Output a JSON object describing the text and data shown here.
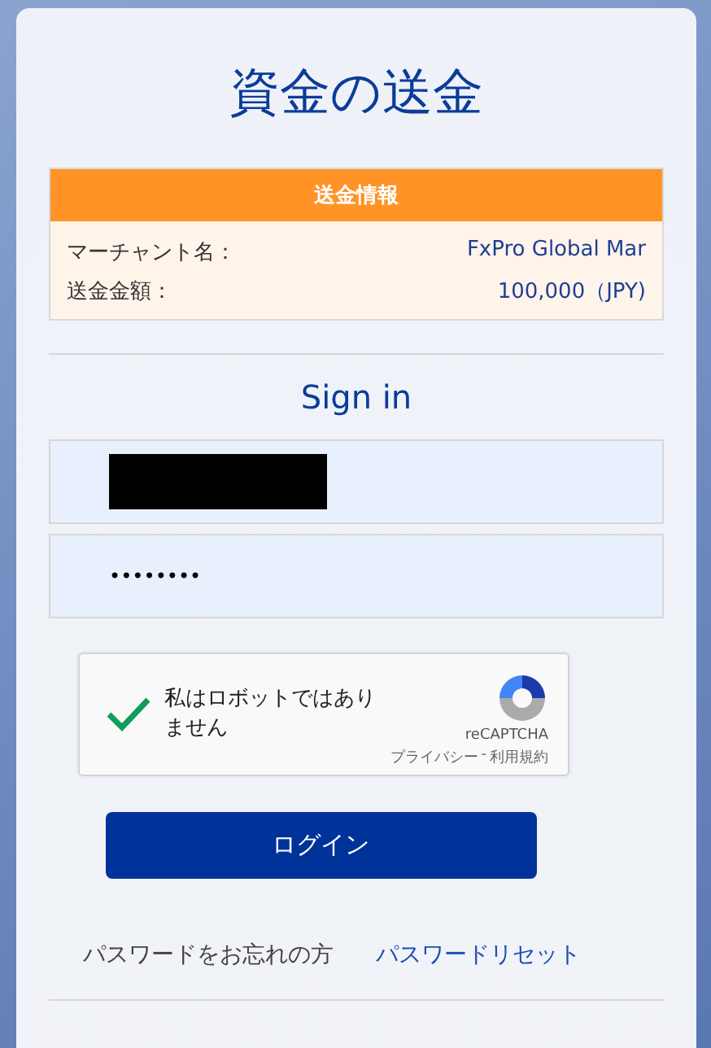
{
  "title": "資金の送金",
  "transfer_info": {
    "header": "送金情報",
    "rows": [
      {
        "label": "マーチャント名：",
        "value": "FxPro Global Mar"
      },
      {
        "label": "送金金額：",
        "value": "100,000（JPY)"
      }
    ]
  },
  "sign_in": {
    "heading": "Sign in",
    "username": {
      "redacted": true
    },
    "password": {
      "value": "••••••••"
    }
  },
  "captcha": {
    "checked": true,
    "label": "私はロボットではありません",
    "brand": "reCAPTCHA",
    "privacy_link": "プライバシー",
    "separator": "-",
    "terms_link": "利用規約"
  },
  "login_button": "ログイン",
  "forgot": {
    "text": "パスワードをお忘れの方",
    "link": "パスワードリセット"
  }
}
